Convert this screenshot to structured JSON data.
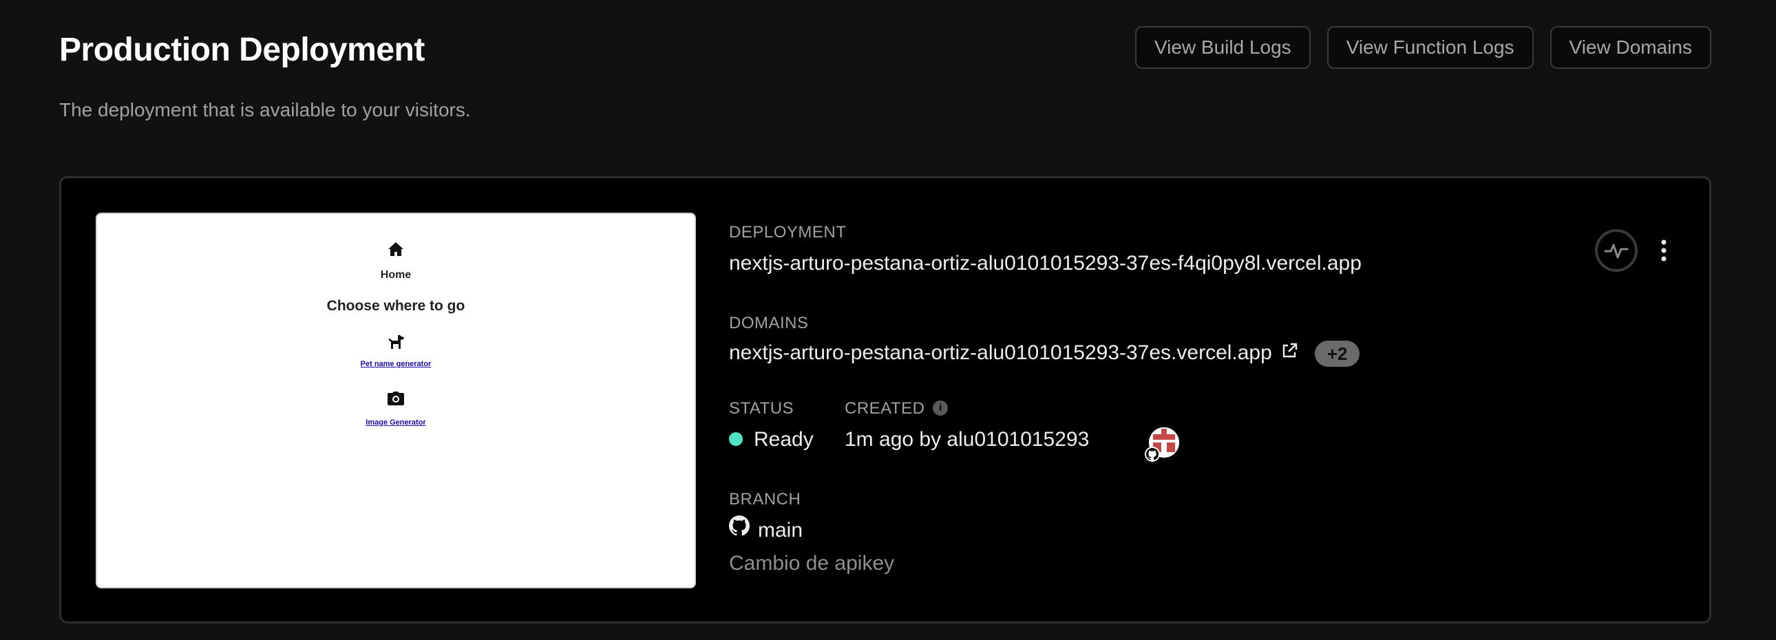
{
  "header": {
    "title": "Production Deployment",
    "subtitle": "The deployment that is available to your visitors.",
    "buttons": {
      "build_logs": "View Build Logs",
      "function_logs": "View Function Logs",
      "domains": "View Domains"
    }
  },
  "preview": {
    "home_label": "Home",
    "heading": "Choose where to go",
    "pet_link": "Pet name generator",
    "image_link": "Image Generator",
    "icons": [
      "home-icon",
      "dog-icon",
      "camera-icon"
    ]
  },
  "deployment": {
    "label": "DEPLOYMENT",
    "url": "nextjs-arturo-pestana-ortiz-alu0101015293-37es-f4qi0py8l.vercel.app"
  },
  "domains": {
    "label": "DOMAINS",
    "url": "nextjs-arturo-pestana-ortiz-alu0101015293-37es.vercel.app",
    "extra_count": "+2"
  },
  "status": {
    "label": "STATUS",
    "value": "Ready",
    "color": "#50e3c2"
  },
  "created": {
    "label": "CREATED",
    "value": "1m ago by alu0101015293"
  },
  "branch": {
    "label": "BRANCH",
    "name": "main",
    "commit_message": "Cambio de apikey"
  },
  "colors": {
    "background": "#111111",
    "card": "#000000",
    "accent_ready": "#50e3c2"
  }
}
